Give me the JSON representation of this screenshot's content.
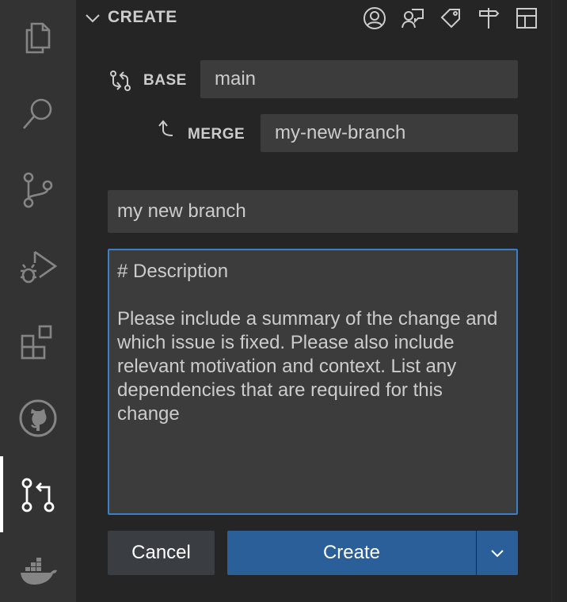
{
  "activity_bar": {
    "items": [
      {
        "name": "explorer",
        "icon": "files-icon"
      },
      {
        "name": "search",
        "icon": "search-icon"
      },
      {
        "name": "source-control",
        "icon": "source-control-icon"
      },
      {
        "name": "run-debug",
        "icon": "run-debug-icon"
      },
      {
        "name": "extensions",
        "icon": "extensions-icon"
      },
      {
        "name": "github",
        "icon": "github-icon"
      },
      {
        "name": "pull-requests",
        "icon": "pull-request-icon",
        "active": true
      },
      {
        "name": "docker",
        "icon": "docker-icon"
      }
    ]
  },
  "header": {
    "title": "CREATE",
    "actions": [
      "account-icon",
      "comment-discussion-icon",
      "tag-icon",
      "milestone-icon",
      "project-icon"
    ]
  },
  "form": {
    "base_label": "BASE",
    "base_value": "main",
    "merge_label": "MERGE",
    "merge_value": "my-new-branch",
    "title_value": "my new branch",
    "description_value": "# Description\n\nPlease include a summary of the change and which issue is fixed. Please also include relevant motivation and context. List any dependencies that are required for this change"
  },
  "buttons": {
    "cancel_label": "Cancel",
    "create_label": "Create"
  },
  "colors": {
    "activity_bar_bg": "#333333",
    "panel_bg": "#252526",
    "input_bg": "#3c3c3c",
    "focus_border": "#3c7fc7",
    "primary_button": "#2b5f99",
    "secondary_button": "#3a3d41"
  }
}
